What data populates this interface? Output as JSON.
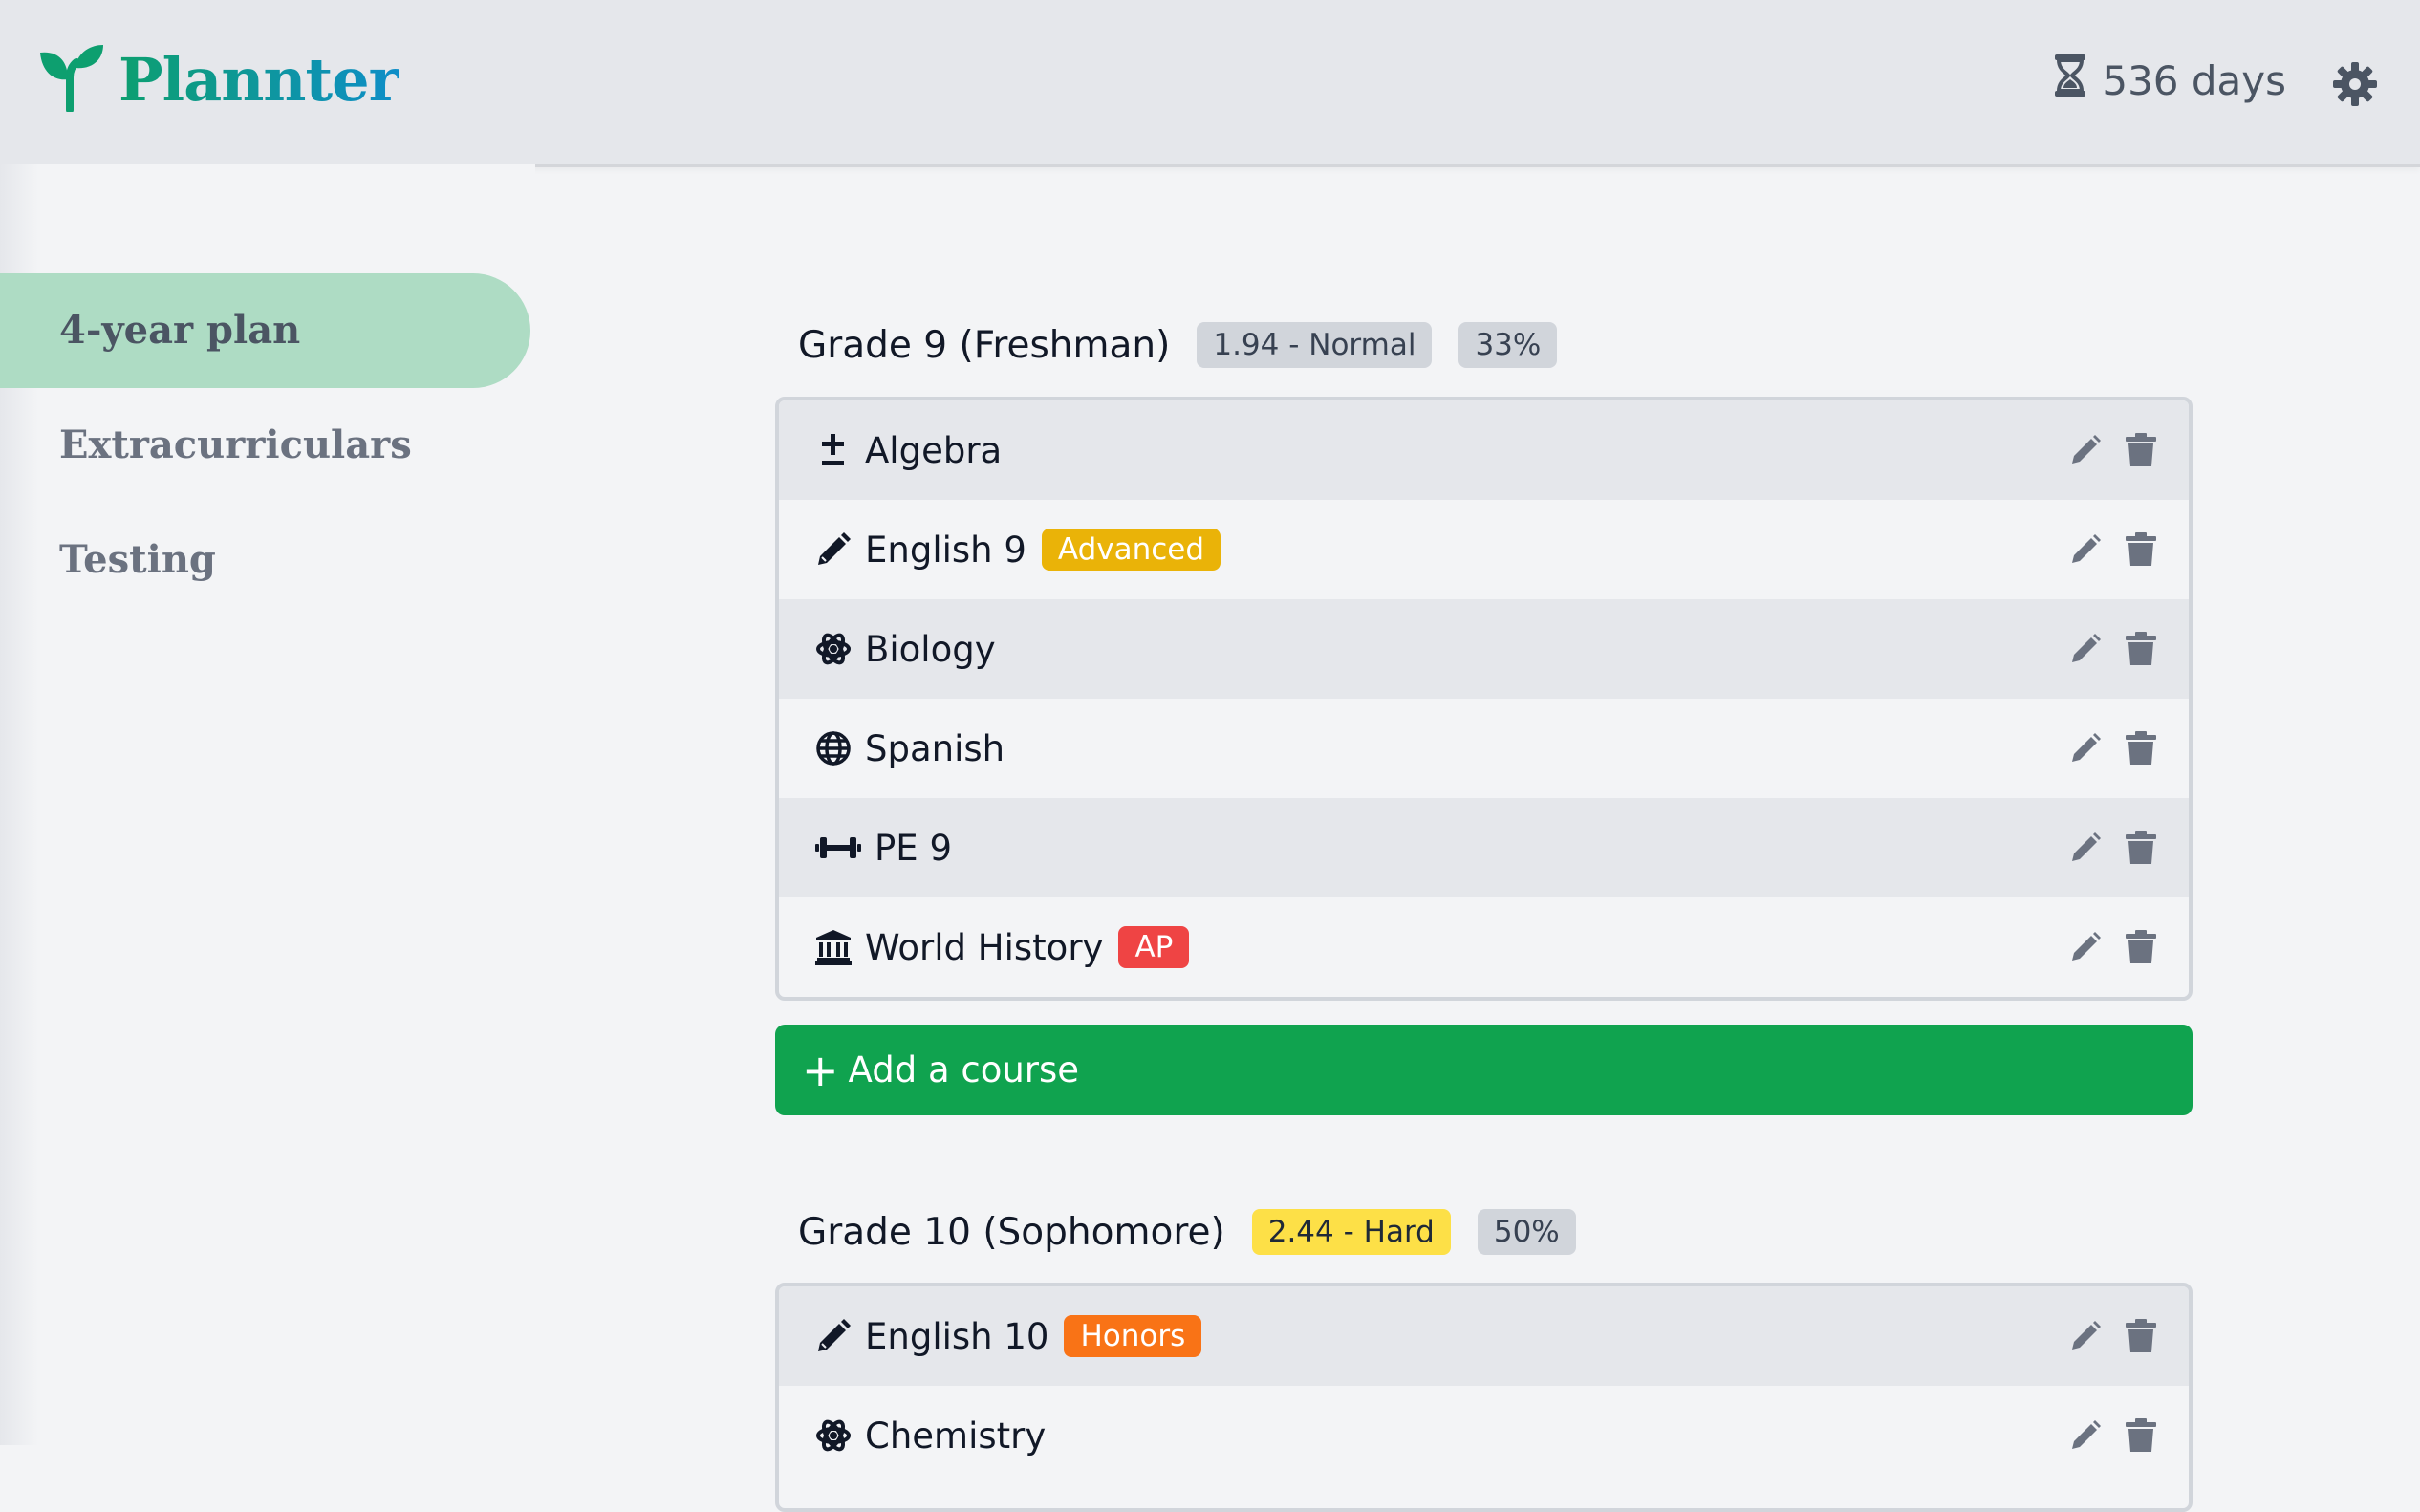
{
  "app": {
    "name": "Plannter",
    "days_remaining": "536 days"
  },
  "sidebar": {
    "items": [
      {
        "label": "4-year plan",
        "active": true
      },
      {
        "label": "Extracurriculars",
        "active": false
      },
      {
        "label": "Testing",
        "active": false
      }
    ]
  },
  "grades": [
    {
      "title": "Grade 9 (Freshman)",
      "difficulty": "1.94 - Normal",
      "progress": "33%",
      "courses": [
        {
          "name": "Algebra",
          "icon": "plus-minus-icon",
          "tag": ""
        },
        {
          "name": "English 9",
          "icon": "pencil-icon",
          "tag": "Advanced"
        },
        {
          "name": "Biology",
          "icon": "atom-icon",
          "tag": ""
        },
        {
          "name": "Spanish",
          "icon": "globe-icon",
          "tag": ""
        },
        {
          "name": "PE 9",
          "icon": "dumbbell-icon",
          "tag": ""
        },
        {
          "name": "World History",
          "icon": "landmark-icon",
          "tag": "AP"
        }
      ]
    },
    {
      "title": "Grade 10 (Sophomore)",
      "difficulty": "2.44 - Hard",
      "progress": "50%",
      "courses": [
        {
          "name": "English 10",
          "icon": "pencil-icon",
          "tag": "Honors"
        },
        {
          "name": "Chemistry",
          "icon": "atom-icon",
          "tag": ""
        }
      ]
    }
  ],
  "add_course_label": "Add a course",
  "colors": {
    "accent_green": "#10a34f",
    "sidebar_active": "#aedcc4",
    "tag_advanced": "#eab308",
    "tag_ap": "#ef4444",
    "tag_honors": "#f97316",
    "badge_hard": "#fde047"
  }
}
